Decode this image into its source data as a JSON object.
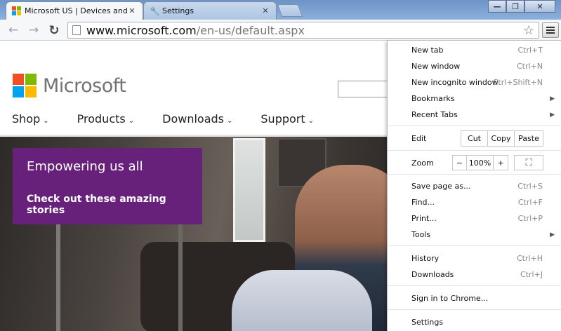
{
  "tabs": [
    {
      "title": "Microsoft US | Devices and S",
      "close": "✕",
      "icon": "microsoft-favicon-icon"
    },
    {
      "title": "Settings",
      "close": "✕",
      "icon": "wrench-icon"
    }
  ],
  "window_controls": {
    "minimize": "—",
    "restore": "❐",
    "close": "✕"
  },
  "toolbar": {
    "back": "←",
    "forward": "→",
    "reload": "↻",
    "url_host": "www.microsoft.com",
    "url_path": "/en-us/default.aspx",
    "star": "☆"
  },
  "page": {
    "logo_text": "Microsoft",
    "logo_colors": [
      "#f25022",
      "#7fba00",
      "#00a4ef",
      "#ffb900"
    ],
    "nav": [
      {
        "label": "Shop"
      },
      {
        "label": "Products"
      },
      {
        "label": "Downloads"
      },
      {
        "label": "Support"
      }
    ],
    "nav_chevron": "⌄",
    "promo": {
      "title": "Empowering us all",
      "link": "Check out these amazing stories",
      "color": "#68217a"
    }
  },
  "menu": {
    "new_tab": {
      "label": "New tab",
      "shortcut": "Ctrl+T"
    },
    "new_window": {
      "label": "New window",
      "shortcut": "Ctrl+N"
    },
    "incognito": {
      "label": "New incognito window",
      "shortcut": "Ctrl+Shift+N"
    },
    "bookmarks": {
      "label": "Bookmarks"
    },
    "recent_tabs": {
      "label": "Recent Tabs"
    },
    "edit": {
      "label": "Edit",
      "cut": "Cut",
      "copy": "Copy",
      "paste": "Paste"
    },
    "zoom": {
      "label": "Zoom",
      "minus": "−",
      "value": "100%",
      "plus": "+",
      "fullscreen": "⛶"
    },
    "save_page": {
      "label": "Save page as...",
      "shortcut": "Ctrl+S"
    },
    "find": {
      "label": "Find...",
      "shortcut": "Ctrl+F"
    },
    "print": {
      "label": "Print...",
      "shortcut": "Ctrl+P"
    },
    "tools": {
      "label": "Tools"
    },
    "history": {
      "label": "History",
      "shortcut": "Ctrl+H"
    },
    "downloads": {
      "label": "Downloads",
      "shortcut": "Ctrl+J"
    },
    "sign_in": {
      "label": "Sign in to Chrome..."
    },
    "settings": {
      "label": "Settings"
    },
    "submenu_arrow": "▶"
  }
}
